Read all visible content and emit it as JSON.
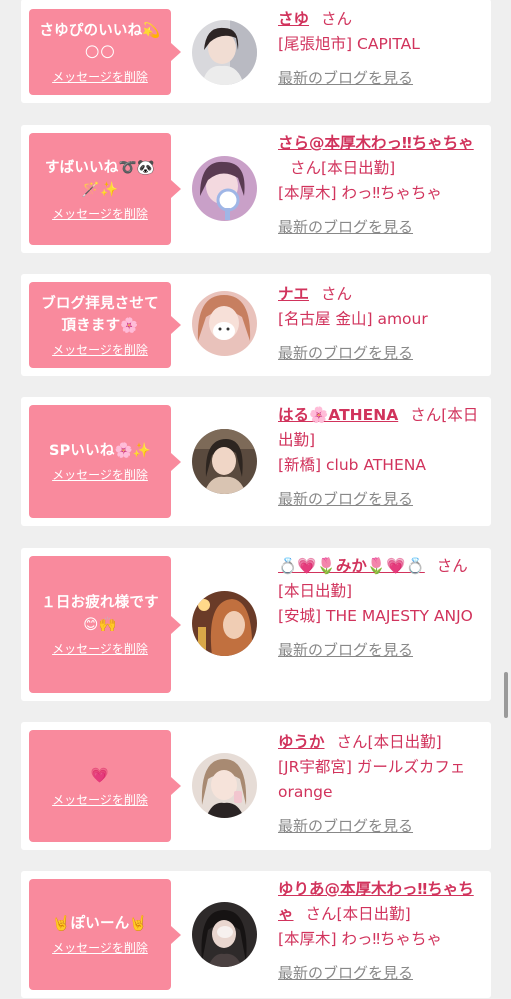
{
  "common": {
    "delete_label": "メッセージを削除",
    "blog_label": "最新のブログを見る",
    "honorific": "さん"
  },
  "cards": [
    {
      "message": "さゆぴのいいね💫🌕🌕",
      "name": "さゆ",
      "status": "",
      "shop": "[尾張旭市] CAPITAL",
      "avatar_icon": "girl-photo-avatar",
      "avatar_color": "#cfcfd4"
    },
    {
      "message": "すばいいね➰🐼🪄✨",
      "name": "さら@本厚木わっ‼︎ちゃちゃ",
      "status": "[本日出勤]",
      "shop": "[本厚木] わっ‼︎ちゃちゃ",
      "avatar_icon": "girl-photo-avatar",
      "avatar_color": "#c9a0c8"
    },
    {
      "message": "ブログ拝見させて頂きます🌸",
      "name": "ナエ",
      "status": "",
      "shop": "[名古屋 金山] amour",
      "avatar_icon": "girl-photo-avatar",
      "avatar_color": "#e6b4a8"
    },
    {
      "message": "SPいいね🌸✨",
      "name": "はる🌸ATHENA",
      "status": "[本日出勤]",
      "shop": "[新橋] club ATHENA",
      "avatar_icon": "girl-photo-avatar",
      "avatar_color": "#6f5c4c"
    },
    {
      "message": "１日お疲れ様です😊🙌",
      "name": "💍💗🌷みか🌷💗💍",
      "status": "[本日出勤]",
      "shop": "[安城] THE MAJESTY ANJO",
      "avatar_icon": "girl-photo-avatar",
      "avatar_color": "#a8613e"
    },
    {
      "message": "💗",
      "name": "ゆうか",
      "status": "[本日出勤]",
      "shop": "[JR宇都宮] ガールズカフェ orange",
      "avatar_icon": "girl-photo-avatar",
      "avatar_color": "#d8c8c0"
    },
    {
      "message": "🤘ぽいーん🤘",
      "name": "ゆりあ@本厚木わっ‼︎ちゃちゃ",
      "status": "[本日出勤]",
      "shop": "[本厚木] わっ‼︎ちゃちゃ",
      "avatar_icon": "girl-photo-avatar",
      "avatar_color": "#3f3a3a"
    }
  ]
}
